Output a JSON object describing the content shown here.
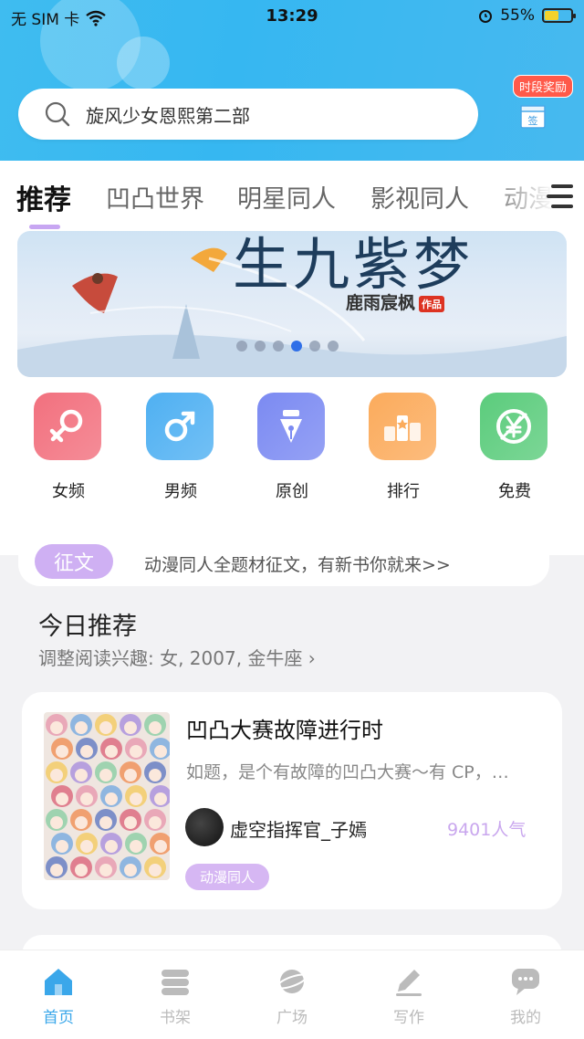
{
  "status_bar": {
    "carrier": "无 SIM 卡",
    "time": "13:29",
    "battery": "55%",
    "battery_level": 0.55
  },
  "search": {
    "placeholder": "旋风少女恩熙第二部"
  },
  "reward": {
    "label": "时段奖励",
    "box_text": "签"
  },
  "tabs": [
    {
      "label": "推荐",
      "active": true
    },
    {
      "label": "凹凸世界",
      "active": false
    },
    {
      "label": "明星同人",
      "active": false
    },
    {
      "label": "影视同人",
      "active": false
    },
    {
      "label": "动漫",
      "active": false
    }
  ],
  "banner": {
    "title": "生九紫梦",
    "author": "鹿雨宸枫",
    "stamp": "作品",
    "dot_count": 6,
    "active_dot": 4
  },
  "categories": [
    {
      "label": "女频",
      "icon": "female-icon",
      "color": "#f2707e"
    },
    {
      "label": "男频",
      "icon": "male-icon",
      "color": "#4fb0f2"
    },
    {
      "label": "原创",
      "icon": "pen-icon",
      "color": "#7b8af2"
    },
    {
      "label": "排行",
      "icon": "ranking-icon",
      "color": "#fbab5c"
    },
    {
      "label": "免费",
      "icon": "yen-icon",
      "color": "#5bcc7c"
    }
  ],
  "notice": {
    "tag": "征文",
    "text": "动漫同人全题材征文，有新书你就来>>"
  },
  "today": {
    "title": "今日推荐",
    "subtitle": "调整阅读兴趣: 女, 2007, 金牛座"
  },
  "book": {
    "title": "凹凸大赛故障进行时",
    "description": "如题，是个有故障的凹凸大赛～有 CP，…",
    "author": "虚空指挥官_子嫣",
    "popularity": "9401人气",
    "genre": "动漫同人"
  },
  "tabbar": [
    {
      "label": "首页",
      "icon": "home-icon",
      "active": true
    },
    {
      "label": "书架",
      "icon": "bookshelf-icon",
      "active": false
    },
    {
      "label": "广场",
      "icon": "planet-icon",
      "active": false
    },
    {
      "label": "写作",
      "icon": "write-icon",
      "active": false
    },
    {
      "label": "我的",
      "icon": "chat-icon",
      "active": false
    }
  ],
  "colors": {
    "accent": "#3aa7ea",
    "purple": "#cfb0f3",
    "header": "#3fbcf0"
  }
}
